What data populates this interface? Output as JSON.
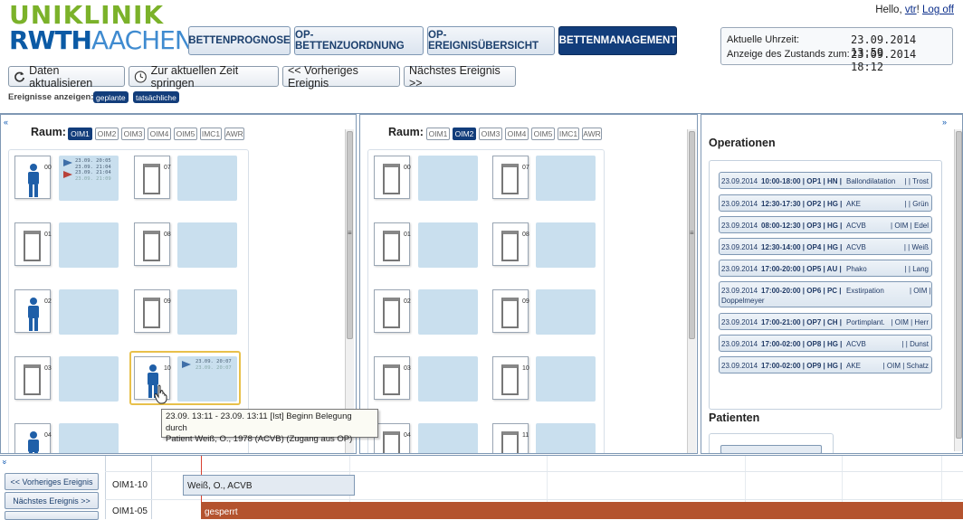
{
  "logo": {
    "line1": "UNIKLINIK",
    "line2a": "RWTH",
    "line2b": "AACHEN"
  },
  "nav": [
    "BETTENPROGNOSE",
    "OP-BETTENZUORDNUNG",
    "OP-EREIGNISÜBERSICHT",
    "BETTENMANAGEMENT"
  ],
  "user": {
    "hello": "Hello,",
    "name": "vtr",
    "sep": "!",
    "logoff": "Log off"
  },
  "time": {
    "current_label": "Aktuelle Uhrzeit:",
    "current_value": "23.09.2014  13:59",
    "state_label": "Anzeige des Zustands zum:",
    "state_value": "23.09.2014  18:12"
  },
  "toolbar": {
    "refresh": "Daten aktualisieren",
    "now": "Zur aktuellen Zeit springen",
    "prev": "<< Vorheriges Ereignis",
    "next": "Nächstes Ereignis >>"
  },
  "events": {
    "label": "Ereignisse anzeigen:",
    "planned": "geplante",
    "actual": "tatsächliche"
  },
  "rooms": {
    "label": "Raum:",
    "tabs": [
      "OIM1",
      "OIM2",
      "OIM3",
      "OIM4",
      "OIM5",
      "IMC1",
      "AWR"
    ]
  },
  "panel1": {
    "active": "OIM1",
    "beds_left": [
      "00",
      "01",
      "02",
      "03",
      "04"
    ],
    "beds_right": [
      "07",
      "08",
      "09",
      "10"
    ],
    "bed00": [
      "23.09. 20:05",
      "23.09. 21:04",
      "23.09. 21:04",
      "23.09. 21:09"
    ],
    "bed10": [
      "23.09. 20:07",
      "23.09. 20:07"
    ]
  },
  "panel2": {
    "active": "OIM2",
    "beds_left": [
      "00",
      "01",
      "02",
      "03",
      "04"
    ],
    "beds_right": [
      "07",
      "08",
      "09",
      "10",
      "11"
    ]
  },
  "operations": {
    "title": "Operationen",
    "items": [
      {
        "date": "23.09.2014",
        "time": "10:00-18:00",
        "room": "OP1",
        "dept": "HN",
        "proc": "Ballondilatation",
        "ward": "",
        "surgeon": "Trost"
      },
      {
        "date": "23.09.2014",
        "time": "12:30-17:30",
        "room": "OP2",
        "dept": "HG",
        "proc": "AKE",
        "ward": "",
        "surgeon": "Grün"
      },
      {
        "date": "23.09.2014",
        "time": "08:00-12:30",
        "room": "OP3",
        "dept": "HG",
        "proc": "ACVB",
        "ward": "OIM",
        "surgeon": "Edel"
      },
      {
        "date": "23.09.2014",
        "time": "12:30-14:00",
        "room": "OP4",
        "dept": "HG",
        "proc": "ACVB",
        "ward": "",
        "surgeon": "Weiß"
      },
      {
        "date": "23.09.2014",
        "time": "17:00-20:00",
        "room": "OP5",
        "dept": "AU",
        "proc": "Phako",
        "ward": "",
        "surgeon": "Lang"
      },
      {
        "date": "23.09.2014",
        "time": "17:00-20:00",
        "room": "OP6",
        "dept": "PC",
        "proc": "Exstirpation",
        "ward": "OIM",
        "surgeon": "Doppelmeyer"
      },
      {
        "date": "23.09.2014",
        "time": "17:00-21:00",
        "room": "OP7",
        "dept": "CH",
        "proc": "Portimplant.",
        "ward": "OIM",
        "surgeon": "Herr"
      },
      {
        "date": "23.09.2014",
        "time": "17:00-02:00",
        "room": "OP8",
        "dept": "HG",
        "proc": "ACVB",
        "ward": "",
        "surgeon": "Dunst"
      },
      {
        "date": "23.09.2014",
        "time": "17:00-02:00",
        "room": "OP9",
        "dept": "HG",
        "proc": "AKE",
        "ward": "OIM",
        "surgeon": "Schatz"
      }
    ]
  },
  "patients": {
    "title": "Patienten"
  },
  "tooltip": {
    "line1": "23.09. 13:11 - 23.09. 13:11 [Ist] Beginn Belegung durch",
    "line2": "Patient Weiß, O., 1978 (ACVB) (Zugang aus OP)"
  },
  "timeline": {
    "prev": "<< Vorheriges Ereignis",
    "next": "Nächstes Ereignis >>",
    "rows": [
      {
        "label": "OIM1-10",
        "bar": "Weiß, O.,  ACVB"
      },
      {
        "label": "OIM1-05",
        "bar": "gesperrt"
      }
    ]
  },
  "colors": {
    "navy": "#123d7b",
    "bedbox": "#c9dfee",
    "blocked": "#b4532e",
    "selected": "#e8c04a",
    "patient": "#1f5fa8"
  }
}
